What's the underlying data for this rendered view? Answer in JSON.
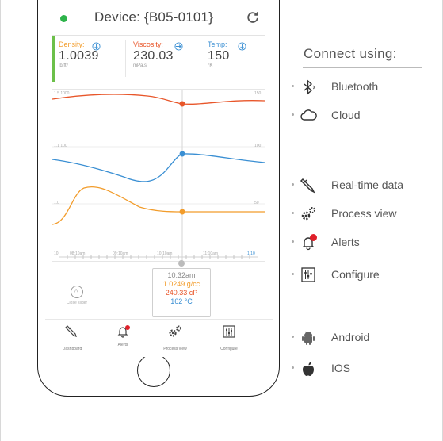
{
  "device": {
    "title": "Device: {B05-0101}"
  },
  "metrics": [
    {
      "label": "Density:",
      "value": "1.0039",
      "unit": "lb/ft³",
      "color": "#f29c2b"
    },
    {
      "label": "Viscosity:",
      "value": "230.03",
      "unit": "mPa.s",
      "color": "#e8562a"
    },
    {
      "label": "Temp:",
      "value": "150",
      "unit": "°K",
      "color": "#3a8fd3"
    }
  ],
  "chart": {
    "left_ticks": [
      "1.5 1000",
      "1.1 100",
      "1.0"
    ],
    "right_ticks": [
      "150",
      "100",
      "50"
    ],
    "x_labels": [
      "10",
      "08:10am",
      "09:10am",
      "10:10am",
      "11:10am",
      "1.10"
    ]
  },
  "chart_data": {
    "type": "line",
    "series": [
      {
        "name": "Viscosity:",
        "color": "#e8562a"
      },
      {
        "name": "Temp:",
        "color": "#3a8fd3"
      },
      {
        "name": "Density:",
        "color": "#f29c2b"
      }
    ]
  },
  "tooltip": {
    "time": "10:32am",
    "density": "1.0249 g/cc",
    "viscosity": "240.33 cP",
    "temp": "162 °C"
  },
  "close_slider": {
    "label": "Close slider"
  },
  "tabs": [
    {
      "label": "Dashboard"
    },
    {
      "label": "Alerts"
    },
    {
      "label": "Process view"
    },
    {
      "label": "Configure"
    }
  ],
  "panel": {
    "connect_title": "Connect using:",
    "connect": [
      {
        "label": "Bluetooth",
        "icon": "bluetooth-icon"
      },
      {
        "label": "Cloud",
        "icon": "cloud-icon"
      }
    ],
    "features": [
      {
        "label": "Real-time data",
        "icon": "probe-icon"
      },
      {
        "label": "Process view",
        "icon": "gears-icon"
      },
      {
        "label": "Alerts",
        "icon": "bell-icon"
      },
      {
        "label": "Configure",
        "icon": "sliders-icon"
      }
    ],
    "platforms": [
      {
        "label": "Android",
        "icon": "android-icon"
      },
      {
        "label": "IOS",
        "icon": "apple-icon"
      }
    ]
  },
  "colors": {
    "accent_green": "#6cc04a",
    "alert_red": "#e0202a",
    "orange": "#f29c2b",
    "red_orange": "#e8562a",
    "blue": "#3a8fd3"
  }
}
